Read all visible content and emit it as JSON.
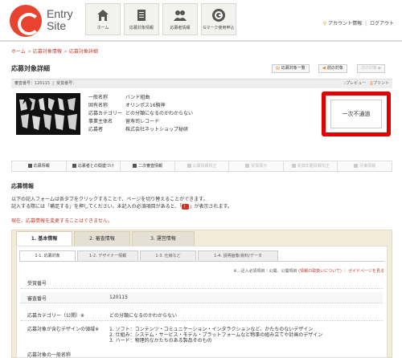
{
  "header": {
    "logo_text_line1": "Entry",
    "logo_text_line2": "Site",
    "nav": [
      {
        "label": "ホーム",
        "icon": "house-icon"
      },
      {
        "label": "応募対象情報",
        "icon": "document-icon"
      },
      {
        "label": "応募者情報",
        "icon": "people-icon"
      },
      {
        "label": "Gマーク使用申込",
        "icon": "g-mark-icon"
      }
    ],
    "account_link": "アカウント情報",
    "logout_link": "ログアウト"
  },
  "breadcrumb": [
    "ホーム",
    "応募対象情報",
    "応募対象詳細"
  ],
  "page_title": "応募対象詳細",
  "toolbar": {
    "list_label": "応募対象一覧",
    "prev_label": "前の対象",
    "next_label": "次の対象"
  },
  "info_bar": {
    "review_no": "審査番号：120115",
    "entry_no": "受賞番号：",
    "preview_label": "プレビュー",
    "print_label": "プリント"
  },
  "spec": {
    "rows": [
      {
        "k": "一般名称",
        "v": "バンド組曲"
      },
      {
        "k": "固有名称",
        "v": "オリンポス16騎神"
      },
      {
        "k": "応募カテゴリー",
        "v": "どの分類になるのかわからない"
      },
      {
        "k": "事業主体名",
        "v": "留寿司レコード"
      },
      {
        "k": "応募者",
        "v": "株式会社ネットショップ秘研"
      }
    ]
  },
  "status": {
    "label": "一次不通過",
    "accent": "#e00000"
  },
  "steps": [
    {
      "label": "応募情報",
      "enabled": true
    },
    {
      "label": "応募者との関連づけ",
      "enabled": true
    },
    {
      "label": "二次審査情報",
      "enabled": true
    },
    {
      "label": "公開情報校正",
      "enabled": false
    },
    {
      "label": "受賞展示",
      "enabled": false
    },
    {
      "label": "受賞年鑑情報校正",
      "enabled": false
    },
    {
      "label": "評価情報",
      "enabled": false
    }
  ],
  "form": {
    "section_title": "応募情報",
    "note1": "以下の記入フォームは各タブをクリックすることで、ページを切り替えることができます。",
    "note2_pre": "記入する際には「補足する」を押してください。未記入の必須項目があると、",
    "note2_badge": "！",
    "note2_post": "が表示されます。",
    "note3": "現在、応募情報を変更することはできません。",
    "main_tabs": [
      "1. 基本情報",
      "2. 審査情報",
      "3. 運営情報"
    ],
    "sub_tabs": [
      "1-1. 応募対象",
      "1-2. デザイナー情報",
      "1-3. 仕様など",
      "1-4. 説明画像/資料/データ"
    ],
    "legend_pre": "※…記入必須項目｜公開、公開項目",
    "legend_link1": "(情報の取扱いについて)",
    "legend_sep": "｜",
    "legend_link2": "ガイドページを見る",
    "fields": [
      {
        "label": "受賞番号",
        "value": ""
      },
      {
        "label": "審査番号",
        "value": "120115"
      },
      {
        "label": "応募カテゴリー（公開）※",
        "value": "どの分類になるのかわからない"
      },
      {
        "label": "応募対象が含むデザインの領域※",
        "value": "1. ソフト：コンテンツ・コミュニケーション・インタラクションなど、かたちのないデザイン"
      },
      {
        "label": "",
        "value": "2. 仕組み：システム・サービス・モデル・プラットフォームなど物事の組み立てや計画のデザイン"
      },
      {
        "label": "",
        "value": "3. ハード：物理的なかたちのある製品そのもの"
      },
      {
        "label": "応募対象の一般名称",
        "value": ""
      }
    ]
  }
}
